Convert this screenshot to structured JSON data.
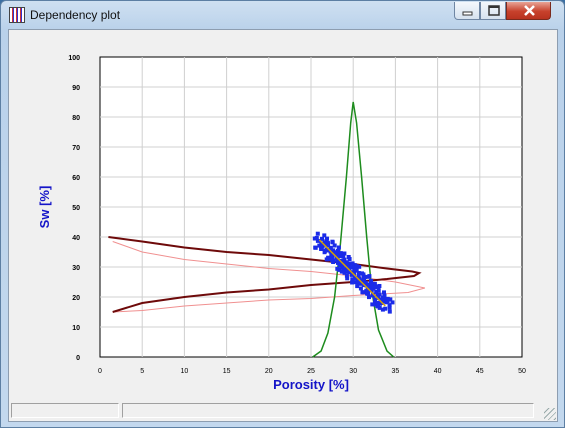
{
  "window": {
    "title": "Dependency plot"
  },
  "chart_data": {
    "type": "scatter",
    "title": "",
    "xlabel": "Porosity [%]",
    "ylabel": "Sw [%]",
    "xlim": [
      0,
      50
    ],
    "ylim": [
      0,
      100
    ],
    "x_ticks": [
      "0",
      "5",
      "10",
      "15",
      "20",
      "25",
      "30",
      "35",
      "40",
      "45",
      "50"
    ],
    "y_ticks": [
      "0",
      "10",
      "20",
      "30",
      "40",
      "50",
      "60",
      "70",
      "80",
      "90",
      "100"
    ],
    "grid": true,
    "colors": {
      "axis_label": "#1414c8",
      "scatter": "#1a2be8",
      "regression": "#d4a000",
      "x_hist": "#1e8c1e",
      "y_hist_dark": "#6e0a0a",
      "y_hist_light": "#f09090"
    },
    "scatter_cloud": {
      "x_range": [
        25.5,
        34.2
      ],
      "y_range": [
        15.0,
        40.5
      ],
      "center": [
        29.8,
        27.5
      ],
      "description_points": [
        [
          25.8,
          39.5
        ],
        [
          26.5,
          37.5
        ],
        [
          27.2,
          36.0
        ],
        [
          27.8,
          34.0
        ],
        [
          28.4,
          32.5
        ],
        [
          29.0,
          30.8
        ],
        [
          29.5,
          29.5
        ],
        [
          30.0,
          28.0
        ],
        [
          30.6,
          26.5
        ],
        [
          31.2,
          25.0
        ],
        [
          31.8,
          23.5
        ],
        [
          32.3,
          22.0
        ],
        [
          32.9,
          20.0
        ],
        [
          33.5,
          18.0
        ],
        [
          34.0,
          16.5
        ]
      ]
    },
    "regression_line": {
      "x": [
        26.0,
        33.8
      ],
      "y": [
        39.0,
        17.0
      ]
    },
    "x_histogram": {
      "points": [
        [
          25.2,
          0
        ],
        [
          26.2,
          2
        ],
        [
          27.0,
          8
        ],
        [
          27.8,
          20
        ],
        [
          28.5,
          38
        ],
        [
          29.2,
          60
        ],
        [
          29.7,
          78
        ],
        [
          30.0,
          85
        ],
        [
          30.4,
          78
        ],
        [
          31.0,
          60
        ],
        [
          31.6,
          40
        ],
        [
          32.2,
          22
        ],
        [
          33.0,
          9
        ],
        [
          34.0,
          2
        ],
        [
          34.8,
          0
        ]
      ]
    },
    "y_histogram_dark": {
      "points": [
        [
          1.0,
          40.0
        ],
        [
          5.0,
          38.5
        ],
        [
          10.0,
          36.5
        ],
        [
          15.0,
          35.0
        ],
        [
          20.0,
          34.0
        ],
        [
          25.0,
          32.5
        ],
        [
          30.0,
          31.0
        ],
        [
          34.0,
          29.5
        ],
        [
          37.0,
          28.5
        ],
        [
          37.8,
          28.0
        ],
        [
          37.2,
          27.0
        ],
        [
          34.0,
          26.0
        ],
        [
          30.0,
          25.0
        ],
        [
          25.0,
          24.0
        ],
        [
          20.0,
          22.5
        ],
        [
          15.0,
          21.5
        ],
        [
          10.0,
          20.0
        ],
        [
          5.0,
          18.0
        ],
        [
          1.5,
          15.0
        ]
      ]
    },
    "y_histogram_light": {
      "points": [
        [
          1.5,
          38.5
        ],
        [
          5.0,
          35.0
        ],
        [
          10.0,
          32.5
        ],
        [
          15.0,
          31.0
        ],
        [
          20.0,
          29.5
        ],
        [
          25.0,
          28.5
        ],
        [
          30.0,
          27.0
        ],
        [
          35.0,
          25.0
        ],
        [
          38.5,
          23.0
        ],
        [
          36.5,
          21.5
        ],
        [
          30.0,
          20.5
        ],
        [
          25.0,
          19.5
        ],
        [
          20.0,
          19.0
        ],
        [
          15.0,
          18.0
        ],
        [
          10.0,
          17.0
        ],
        [
          5.0,
          15.5
        ],
        [
          1.5,
          15.0
        ]
      ]
    }
  },
  "status_bar": {
    "pane1": "",
    "pane2": ""
  }
}
